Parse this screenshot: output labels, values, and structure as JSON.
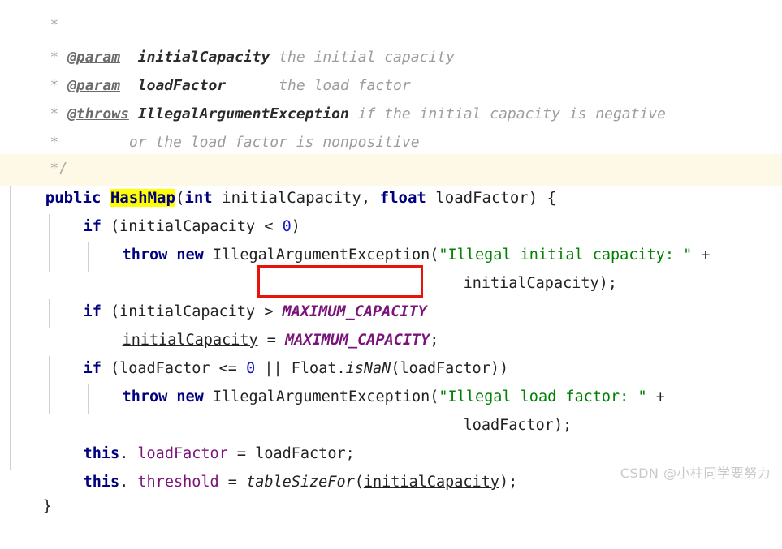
{
  "editor": {
    "background": "#ffffff",
    "highlight_line_color": "#fdf9e6",
    "token_highlight_color": "#ffff00",
    "annotation_box_color": "#e8140c",
    "indent_guide_color": "#d0d0d0"
  },
  "javadoc": {
    "top_fragment": "*",
    "lines": [
      {
        "star": "*",
        "tag": "@param",
        "name": "initialCapacity",
        "desc": "the initial capacity"
      },
      {
        "star": "*",
        "tag": "@param",
        "name": "loadFactor",
        "desc": "the load factor"
      },
      {
        "star": "*",
        "tag": "@throws",
        "name": "IllegalArgumentException",
        "desc": "if the initial capacity is negative"
      },
      {
        "star": "*",
        "tag": "",
        "name": "",
        "desc": "or the load factor is nonpositive"
      }
    ],
    "close": "*/"
  },
  "code": {
    "signature": {
      "modifier": "public",
      "method_name": "HashMap",
      "open_paren": "(",
      "type1": "int",
      "arg1": "initialCapacity",
      "comma": ", ",
      "type2": "float",
      "arg2": "loadFactor",
      "close_paren": ") {"
    },
    "line_if_negative": {
      "kw": "if",
      "expr_open": " (",
      "var": "initialCapacity",
      "op": " < ",
      "num": "0",
      "expr_close": ")"
    },
    "line_throw_capacity": {
      "kw_throw": "throw",
      "kw_new": "new",
      "exception": "IllegalArgumentException",
      "open": "(",
      "string": "\"Illegal initial capacity: \"",
      "plus": " +"
    },
    "line_throw_capacity_cont": {
      "var": "initialCapacity",
      "tail": ");"
    },
    "line_if_max": {
      "kw": "if",
      "expr_open": " (",
      "var": "initialCapacity",
      "op": " > ",
      "constant": "MAXIMUM_CAPACITY"
    },
    "line_assign_max": {
      "var": "initialCapacity",
      "op": " = ",
      "constant": "MAXIMUM_CAPACITY",
      "semi": ";"
    },
    "line_if_loadfactor": {
      "kw": "if",
      "expr_open": " (",
      "var": "loadFactor",
      "op": " <= ",
      "num": "0",
      "or": " || ",
      "cls": "Float.",
      "method": "isNaN",
      "args": "(loadFactor))"
    },
    "line_throw_loadfactor": {
      "kw_throw": "throw",
      "kw_new": "new",
      "exception": "IllegalArgumentException",
      "open": "(",
      "string": "\"Illegal load factor: \"",
      "plus": " +"
    },
    "line_throw_loadfactor_cont": {
      "var": "loadFactor",
      "tail": ");"
    },
    "line_this_loadfactor": {
      "kw": "this",
      "dot": ". ",
      "field": "loadFactor",
      "op": " = ",
      "value": "loadFactor",
      "semi": ";"
    },
    "line_this_threshold": {
      "kw": "this",
      "dot": ". ",
      "field": "threshold",
      "op": " = ",
      "method": "tableSizeFor",
      "open": "(",
      "arg": "initialCapacity",
      "tail": ");"
    },
    "closing_brace": "}"
  },
  "watermark": {
    "text": "CSDN @小柱同学要努力"
  }
}
